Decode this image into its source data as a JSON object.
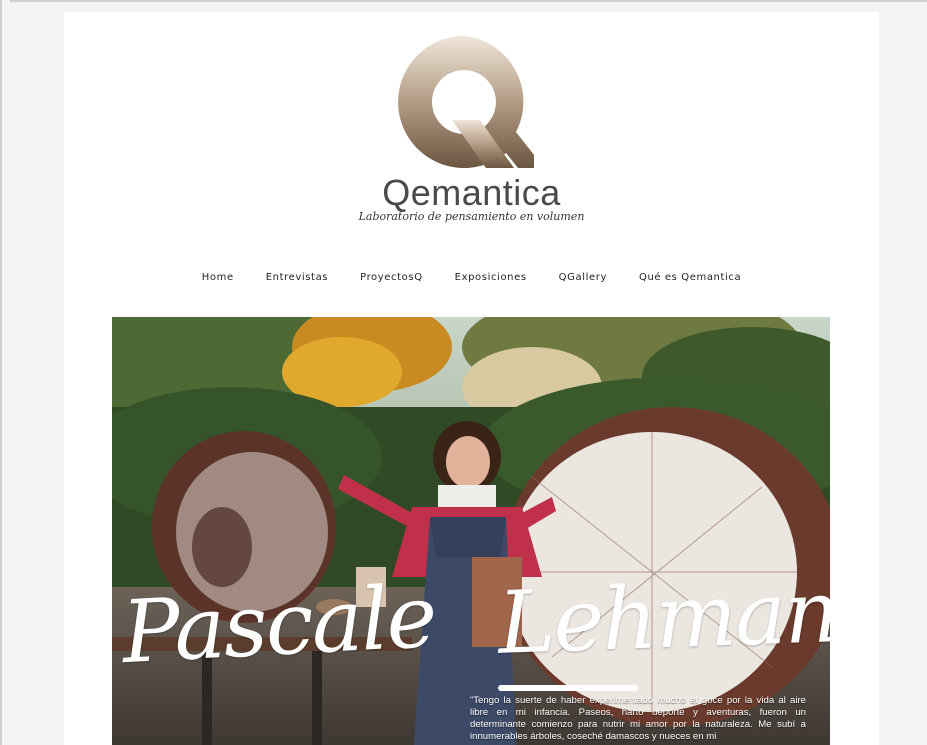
{
  "site": {
    "name": "Qemantica",
    "tagline": "Laboratorio de pensamiento en volumen",
    "logo_icon": "q-logo-icon"
  },
  "nav": {
    "items": [
      {
        "label": "Home"
      },
      {
        "label": "Entrevistas"
      },
      {
        "label": "ProyectosQ"
      },
      {
        "label": "Exposiciones"
      },
      {
        "label": "QGallery"
      },
      {
        "label": "Qué es Qemantica"
      }
    ]
  },
  "hero": {
    "name_first": "Pascale",
    "name_last": "Lehmann",
    "quote": "“Tengo la suerte de haber experimentado mucho el goce por la vida al aire libre en mi infancia. Paseos, harto deporte y aventuras, fueron un determinante comienzo para nutrir mi amor por la naturaleza. Me subí a innumerables árboles, coseché damascos y nueces en mi"
  },
  "colors": {
    "page_bg": "#f3f3f3",
    "content_bg": "#ffffff",
    "logo_gradient_top": "#e8dccd",
    "logo_gradient_bottom": "#6f5a44",
    "text": "#222222"
  }
}
